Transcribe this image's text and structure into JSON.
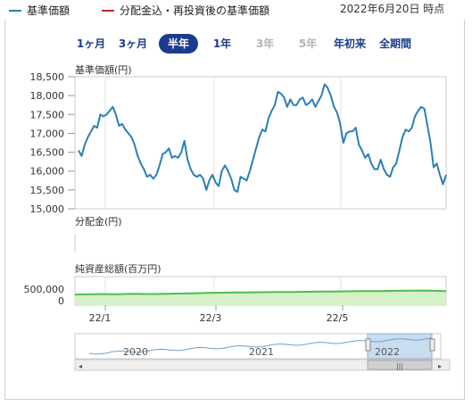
{
  "legend": {
    "items": [
      {
        "label": "基準価額",
        "color": "#2a7fb8"
      },
      {
        "label": "分配金込・再投資後の基準価額",
        "color": "#c0282d"
      }
    ],
    "date": "2022年6月20日 時点"
  },
  "range_buttons": [
    {
      "label": "1ヶ月",
      "state": "normal"
    },
    {
      "label": "3ヶ月",
      "state": "normal"
    },
    {
      "label": "半年",
      "state": "active"
    },
    {
      "label": "1年",
      "state": "normal"
    },
    {
      "label": "3年",
      "state": "disabled"
    },
    {
      "label": "5年",
      "state": "disabled"
    },
    {
      "label": "年初来",
      "state": "normal"
    },
    {
      "label": "全期間",
      "state": "normal"
    }
  ],
  "chart_data": [
    {
      "type": "line",
      "title": "基準価額(円)",
      "ylim": [
        15000,
        18500
      ],
      "yticks": [
        "18,500",
        "18,000",
        "17,500",
        "17,000",
        "16,500",
        "16,000",
        "15,500",
        "15,000"
      ],
      "series": [
        {
          "name": "基準価額",
          "color": "#2a7fb8",
          "values": [
            16550,
            16400,
            16700,
            16900,
            17050,
            17200,
            17150,
            17500,
            17450,
            17500,
            17600,
            17700,
            17500,
            17200,
            17250,
            17100,
            17000,
            16900,
            16700,
            16400,
            16200,
            16050,
            15850,
            15900,
            15800,
            15900,
            16150,
            16450,
            16500,
            16600,
            16350,
            16400,
            16350,
            16500,
            16800,
            16300,
            16050,
            15900,
            15850,
            15900,
            15800,
            15500,
            15750,
            15900,
            15700,
            15600,
            16000,
            16150,
            16000,
            15800,
            15500,
            15450,
            15850,
            15800,
            15750,
            16000,
            16300,
            16600,
            16900,
            17100,
            17050,
            17400,
            17600,
            17750,
            18100,
            18050,
            17950,
            17700,
            17900,
            17750,
            17750,
            17900,
            17950,
            17750,
            17800,
            17900,
            17700,
            17850,
            18000,
            18300,
            18200,
            18000,
            17700,
            17550,
            17250,
            16750,
            17000,
            17050,
            17050,
            17150,
            16700,
            16550,
            16350,
            16450,
            16200,
            16050,
            16050,
            16300,
            16050,
            15900,
            15850,
            16100,
            16200,
            16550,
            16900,
            17100,
            17050,
            17150,
            17450,
            17600,
            17700,
            17650,
            17200,
            16750,
            16100,
            16200,
            15900,
            15650,
            15900
          ]
        }
      ]
    },
    {
      "type": "bar",
      "title": "分配金(円)",
      "values": []
    },
    {
      "type": "area",
      "title": "純資産総額(百万円)",
      "ylim": [
        0,
        500000
      ],
      "yticks": [
        "500,000",
        "0"
      ],
      "xlabels": [
        "22/1",
        "22/3",
        "22/5"
      ],
      "series": [
        {
          "color": "#4bbf4b",
          "values": [
            330000,
            335000,
            340000,
            345000,
            345000,
            342000,
            345000,
            350000,
            352000,
            348000,
            346000,
            350000,
            355000,
            360000,
            365000,
            370000,
            375000,
            380000,
            385000,
            390000,
            392000,
            395000,
            398000,
            400000,
            402000,
            405000,
            408000,
            410000,
            412000,
            415000,
            418000,
            420000,
            422000,
            425000,
            428000,
            430000,
            432000,
            435000,
            438000,
            440000,
            442000,
            445000,
            448000,
            450000,
            452000,
            455000,
            450000,
            445000,
            440000
          ]
        }
      ]
    }
  ],
  "navigator": {
    "year_labels": [
      "2020",
      "2021",
      "2022"
    ]
  }
}
